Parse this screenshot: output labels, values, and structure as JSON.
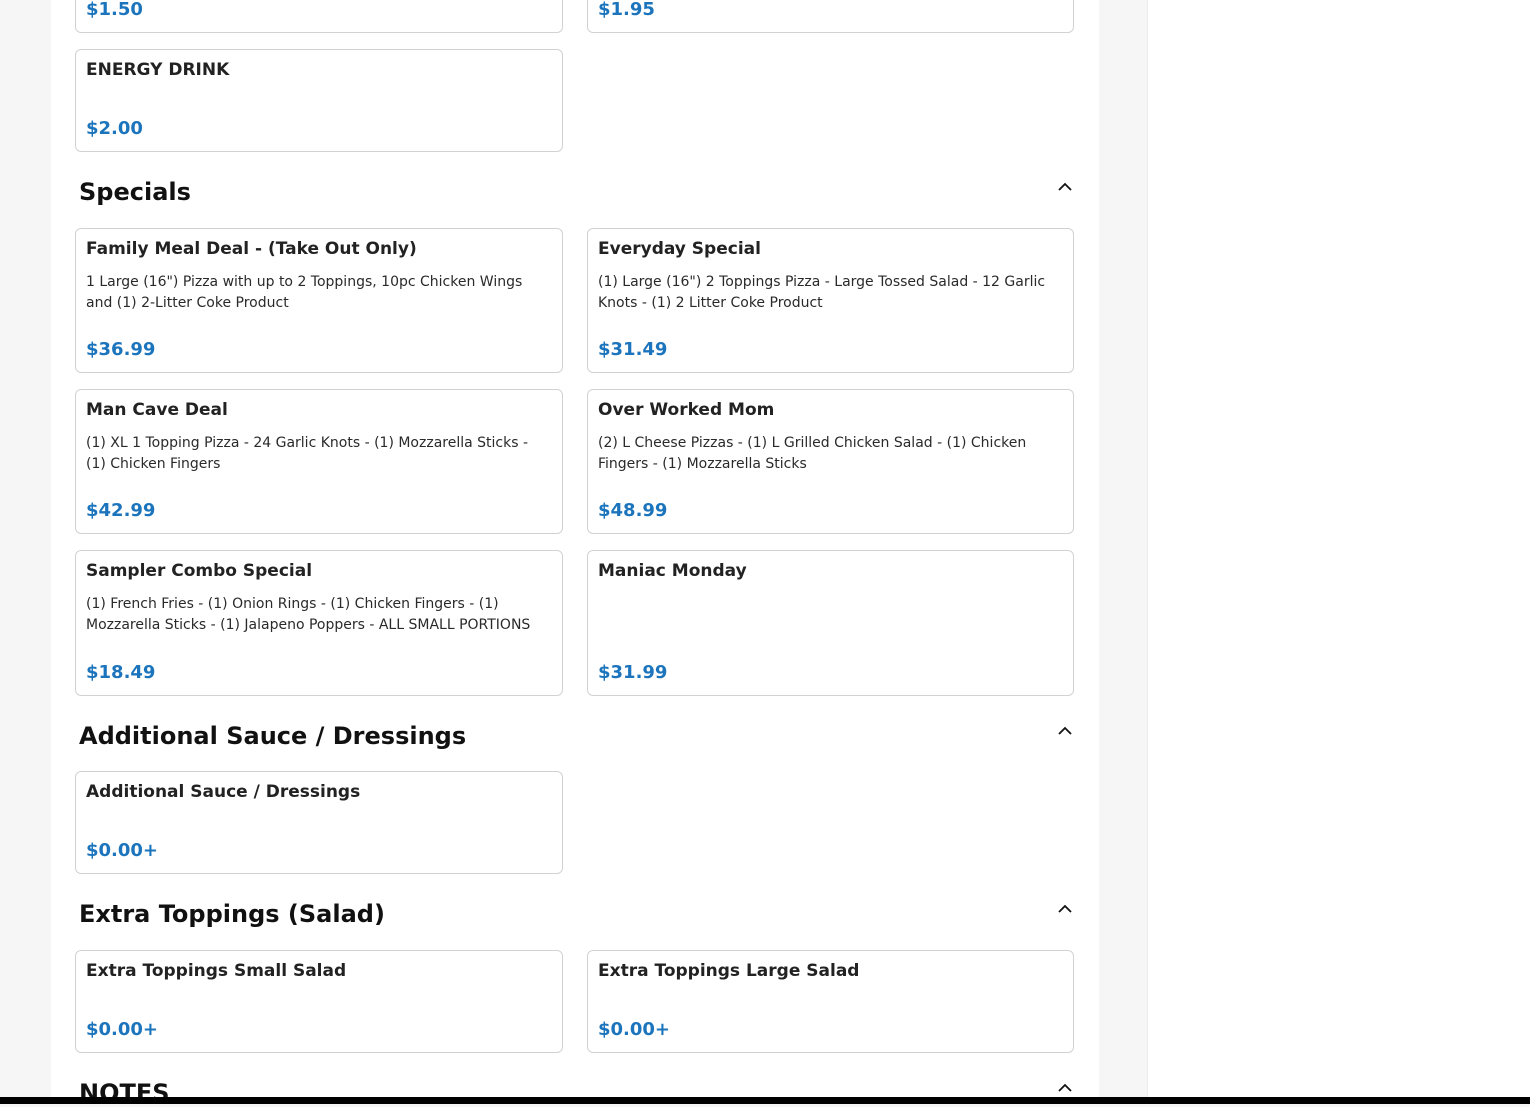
{
  "sections": {
    "drinks": {
      "items": [
        {
          "price": "$1.50"
        },
        {
          "price": "$1.95"
        },
        {
          "name": "ENERGY DRINK",
          "price": "$2.00"
        }
      ]
    },
    "specials": {
      "title": "Specials",
      "toggle_icon": "chevron-up-icon",
      "items": [
        {
          "name": "Family Meal Deal - (Take Out Only)",
          "desc": "1 Large (16\") Pizza with up to 2 Toppings, 10pc Chicken Wings and (1) 2-Litter Coke Product",
          "price": "$36.99"
        },
        {
          "name": "Everyday Special",
          "desc": "(1) Large (16\") 2 Toppings Pizza - Large Tossed Salad - 12 Garlic Knots - (1) 2 Litter Coke Product",
          "price": "$31.49"
        },
        {
          "name": "Man Cave Deal",
          "desc": "(1) XL 1 Topping Pizza - 24 Garlic Knots - (1) Mozzarella Sticks - (1) Chicken Fingers",
          "price": "$42.99"
        },
        {
          "name": "Over Worked Mom",
          "desc": "(2) L Cheese Pizzas - (1) L Grilled Chicken Salad - (1) Chicken Fingers - (1) Mozzarella Sticks",
          "price": "$48.99"
        },
        {
          "name": "Sampler Combo Special",
          "desc": "(1) French Fries - (1) Onion Rings - (1) Chicken Fingers - (1) Mozzarella Sticks - (1) Jalapeno Poppers - ALL SMALL PORTIONS",
          "price": "$18.49"
        },
        {
          "name": "Maniac Monday",
          "desc": "",
          "price": "$31.99"
        }
      ]
    },
    "sauces": {
      "title": "Additional Sauce / Dressings",
      "toggle_icon": "chevron-up-icon",
      "items": [
        {
          "name": "Additional Sauce / Dressings",
          "price": "$0.00+"
        }
      ]
    },
    "extra_toppings": {
      "title": "Extra Toppings (Salad)",
      "toggle_icon": "chevron-up-icon",
      "items": [
        {
          "name": "Extra Toppings Small Salad",
          "price": "$0.00+"
        },
        {
          "name": "Extra Toppings Large Salad",
          "price": "$0.00+"
        }
      ]
    },
    "notes": {
      "title": "NOTES",
      "toggle_icon": "chevron-up-icon"
    }
  },
  "colors": {
    "price": "#1c75bc",
    "card_border": "#d2d2d2",
    "page_background": "#f6f6f6"
  }
}
